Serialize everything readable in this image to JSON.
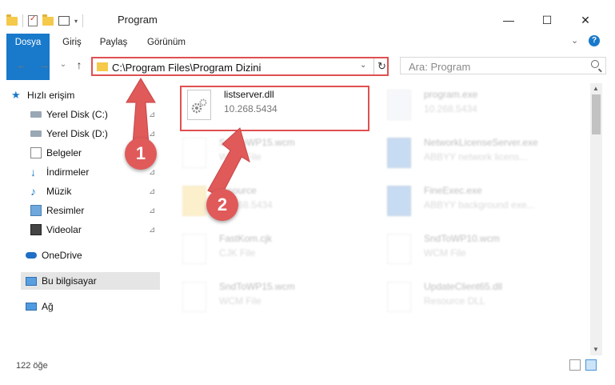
{
  "window": {
    "title": "Program",
    "controls": {
      "minimize": "—",
      "maximize": "☐",
      "close": "✕"
    }
  },
  "ribbon": {
    "tabs": [
      {
        "label": "Dosya",
        "active": true
      },
      {
        "label": "Giriş"
      },
      {
        "label": "Paylaş"
      },
      {
        "label": "Görünüm"
      }
    ],
    "expand_glyph": "⌄",
    "help_glyph": "?"
  },
  "navigation": {
    "back": "←",
    "forward": "→",
    "recent": "⌄",
    "up": "↑"
  },
  "address": {
    "path": "C:\\Program Files\\Program Dizini",
    "refresh_glyph": "↻",
    "dropdown_glyph": "⌄"
  },
  "search": {
    "placeholder": "Ara: Program"
  },
  "sidebar": {
    "items": [
      {
        "label": "Hızlı erişim",
        "icon": "star-icon",
        "pinned": false
      },
      {
        "label": "Yerel Disk (C:)",
        "icon": "drive-icon",
        "pinned": true
      },
      {
        "label": "Yerel Disk (D:)",
        "icon": "drive-icon",
        "pinned": true
      },
      {
        "label": "Belgeler",
        "icon": "documents-icon",
        "pinned": true
      },
      {
        "label": "İndirmeler",
        "icon": "download-icon",
        "pinned": true
      },
      {
        "label": "Müzik",
        "icon": "music-icon",
        "pinned": true
      },
      {
        "label": "Resimler",
        "icon": "pictures-icon",
        "pinned": true
      },
      {
        "label": "Videolar",
        "icon": "video-icon",
        "pinned": true
      },
      {
        "label": "OneDrive",
        "icon": "cloud-icon",
        "pinned": false
      },
      {
        "label": "Bu bilgisayar",
        "icon": "computer-icon",
        "pinned": false,
        "selected": true
      },
      {
        "label": "Ağ",
        "icon": "network-icon",
        "pinned": false
      }
    ],
    "pin_glyph": "📌"
  },
  "files": [
    {
      "name": "listserver.dll",
      "sub": "10.268.5434",
      "icon": "dll-gear-icon",
      "highlighted": true
    },
    {
      "name": "program.exe",
      "sub": "10.268.5434",
      "icon": "exe-icon"
    },
    {
      "name": "SndToWP15.wcm",
      "sub": "WCM File",
      "icon": "file-icon"
    },
    {
      "name": "NetworkLicenseServer.exe",
      "sub": "ABBYY network licens...",
      "icon": "app-window-icon"
    },
    {
      "name": "resource",
      "sub": "10.268.5434",
      "icon": "folder-icon"
    },
    {
      "name": "FineExec.exe",
      "sub": "ABBYY background exe...",
      "icon": "app-window-icon"
    },
    {
      "name": "FastKom.cjk",
      "sub": "CJK File",
      "icon": "file-icon"
    },
    {
      "name": "SndToWP10.wcm",
      "sub": "WCM File",
      "icon": "file-icon"
    },
    {
      "name": "SndToWP15.wcm",
      "sub": "WCM File",
      "icon": "file-icon"
    },
    {
      "name": "UpdateClient65.dll",
      "sub": "Resource DLL",
      "icon": "dll-gear-icon"
    }
  ],
  "status": {
    "count": "122 öğe"
  },
  "callouts": [
    "1",
    "2"
  ],
  "colors": {
    "accent": "#1979ca",
    "highlight_border": "#e05050",
    "callout": "#e05a5a"
  }
}
